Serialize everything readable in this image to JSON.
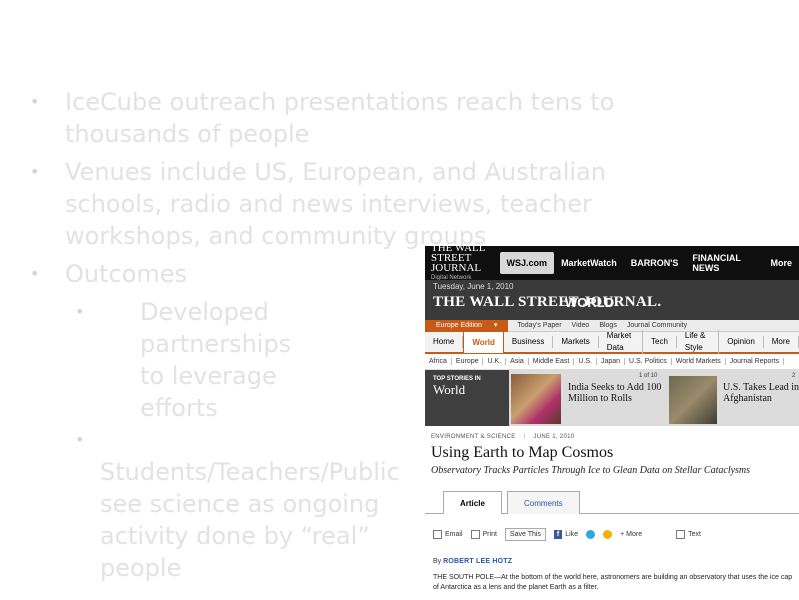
{
  "bullets": [
    {
      "text": "IceCube outreach presentations reach tens to thousands of people"
    },
    {
      "text": "Venues include US, European, and Australian schools, radio and news interviews, teacher workshops, and community groups"
    },
    {
      "text": "Outcomes",
      "sub": [
        {
          "text": "Developed partnerships to leverage efforts"
        },
        {
          "text": "Students/Teachers/Public see science as ongoing activity done by “real” people"
        }
      ]
    }
  ],
  "wsj": {
    "topbar": {
      "logo": "THE WALL STREET JOURNAL",
      "logo_sub": "Digital Network",
      "items": [
        "WSJ.com",
        "MarketWatch",
        "BARRON'S",
        "FINANCIAL NEWS",
        "More"
      ]
    },
    "masthead": {
      "date": "Tuesday, June 1, 2010",
      "name": "THE WALL STREET JOURNAL.",
      "section": "WORLD"
    },
    "editionbar": {
      "edition": "Europe Edition",
      "items": [
        "Today's Paper",
        "Video",
        "Blogs",
        "Journal Community"
      ]
    },
    "nav": [
      "Home",
      "World",
      "Business",
      "Markets",
      "Market Data",
      "Tech",
      "Life & Style",
      "Opinion",
      "More"
    ],
    "subnav": [
      "Africa",
      "Europe",
      "U.K.",
      "Asia",
      "Middle East",
      "U.S.",
      "Japan",
      "U.S. Politics",
      "World Markets",
      "Journal Reports"
    ],
    "topstories": {
      "label_small": "TOP STORIES IN",
      "label_big": "World",
      "count1": "1 of 10",
      "headline1": "India Seeks to Add 100 Million to Rolls",
      "count2": "2",
      "headline2": "U.S. Takes Lead in Afghanistan"
    },
    "article": {
      "kicker": "ENVIRONMENT & SCIENCE",
      "kicker_date": "JUNE 1, 2010",
      "headline": "Using Earth to Map Cosmos",
      "deck": "Observatory Tracks Particles Through Ice to Glean Data on Stellar Cataclysms",
      "tab_article": "Article",
      "tab_comments": "Comments",
      "tools": {
        "email": "Email",
        "print": "Print",
        "save": "Save This",
        "like": "Like",
        "more": "+ More",
        "text": "Text"
      },
      "byline_prefix": "By",
      "byline": "ROBERT LEE HOTZ",
      "body": "THE SOUTH POLE—At the bottom of the world here, astronomers are building an observatory that uses the ice cap of Antarctica as a lens and the planet Earth as a filter."
    }
  }
}
